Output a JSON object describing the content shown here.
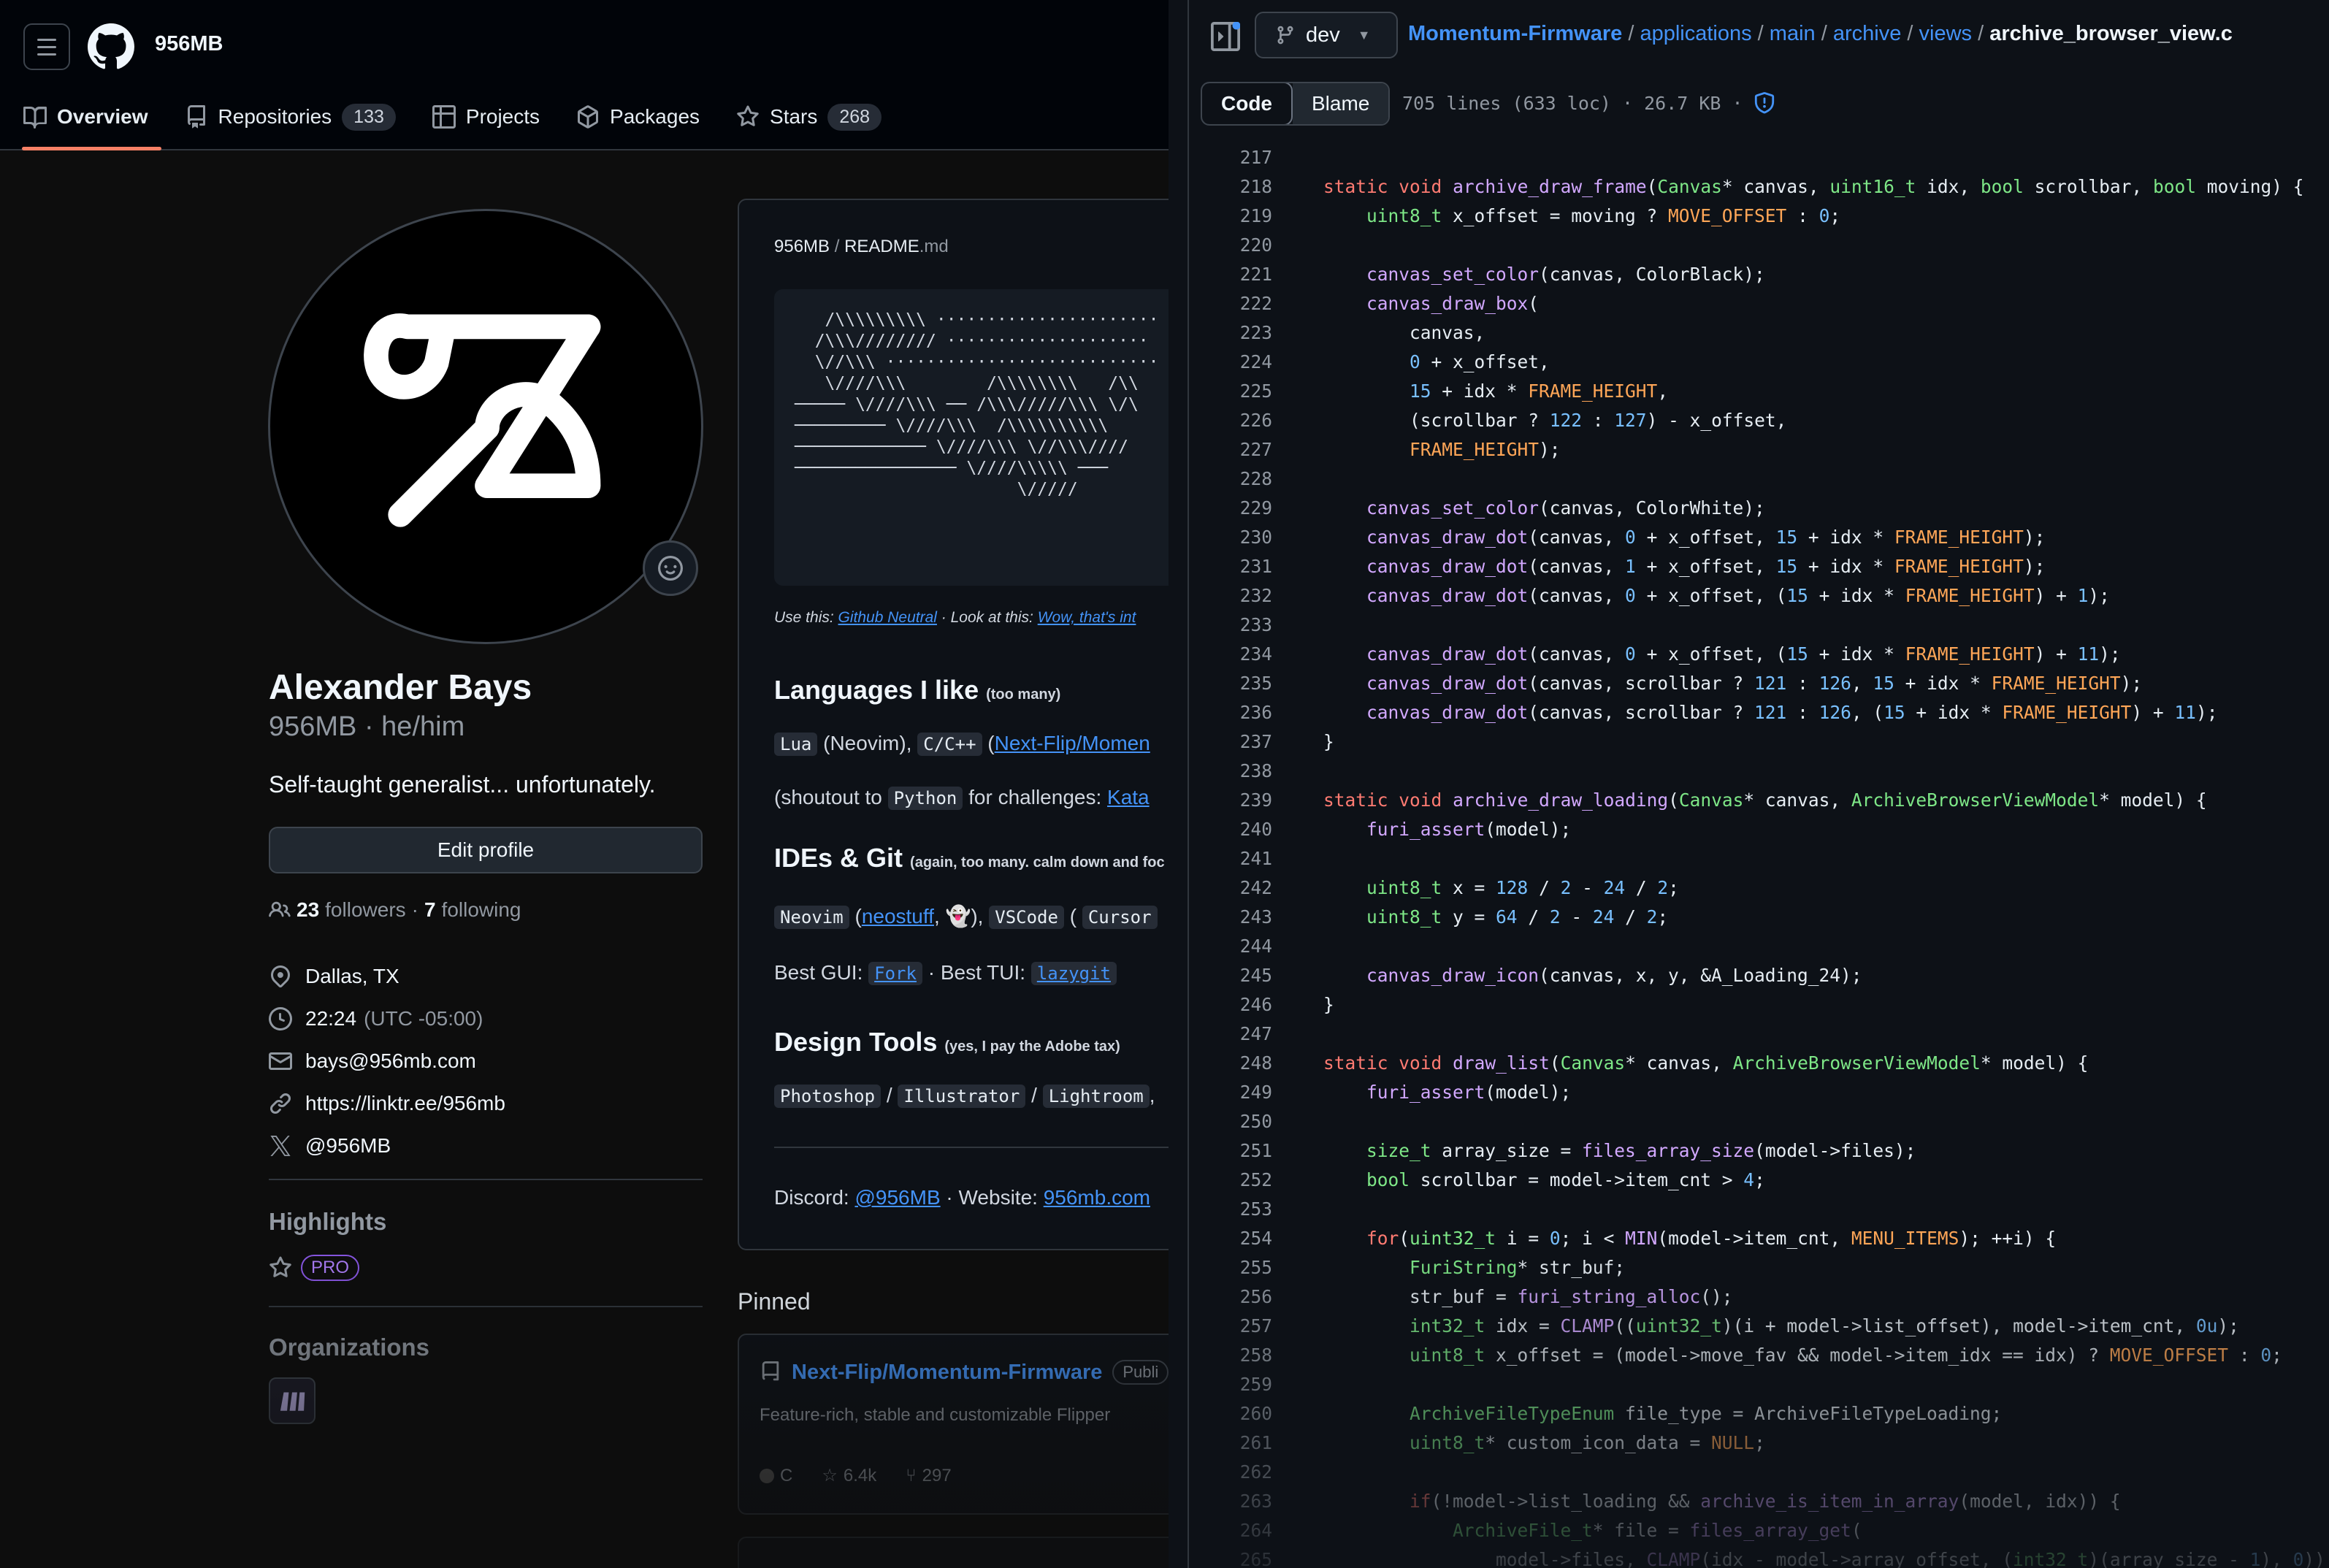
{
  "profile_header": {
    "owner": "956MB",
    "nav": [
      {
        "label": "Overview",
        "count": ""
      },
      {
        "label": "Repositories",
        "count": "133"
      },
      {
        "label": "Projects",
        "count": ""
      },
      {
        "label": "Packages",
        "count": ""
      },
      {
        "label": "Stars",
        "count": "268"
      }
    ]
  },
  "profile": {
    "name": "Alexander Bays",
    "login": "956MB · he/him",
    "bio": "Self-taught generalist... unfortunately.",
    "edit_button": "Edit profile",
    "followers": "23",
    "followers_label": "followers",
    "dot": "·",
    "following": "7",
    "following_label": "following",
    "location": "Dallas, TX",
    "time": "22:24",
    "timezone": "(UTC -05:00)",
    "email": "bays@956mb.com",
    "website": "https://linktr.ee/956mb",
    "x_handle": "@956MB",
    "highlights_title": "Highlights",
    "pro_badge": "PRO",
    "organizations_title": "Organizations"
  },
  "readme": {
    "path_owner": "956MB",
    "path_sep": "/",
    "path_file": "README",
    "path_ext": ".md",
    "ascii_art": "   /\\\\\\\\\\\\\\\\\\ ······················\n  /\\\\\\//////// ····················\n  \\//\\\\\\ ···························\n   \\////\\\\\\        /\\\\\\\\\\\\\\\\   /\\\\\n───── \\////\\\\\\ ── /\\\\\\/////\\\\\\ \\/\\\n───────── \\////\\\\\\  /\\\\\\\\\\\\\\\\\\\\\n───────────── \\////\\\\\\ \\//\\\\\\////\n──────────────── \\////\\\\\\\\\\ ───\n                      \\/////",
    "use_this_label": "Use this:",
    "use_this_link": "Github Neutral",
    "look_label": "· Look at this:",
    "look_link": "Wow, that's int",
    "languages_title": "Languages I like",
    "languages_note": "(too many)",
    "lang_lua": "Lua",
    "lang_neovim": "(Neovim),",
    "lang_cpp": "C/C++",
    "lang_paren": "(",
    "lang_link": "Next-Flip/Momen",
    "shoutout_pre": "(shoutout to",
    "lang_python": "Python",
    "shoutout_post": "for challenges:",
    "shoutout_link": "Kata",
    "ides_title": "IDEs & Git",
    "ides_note": "(again, too many. calm down and foc",
    "ide_neovim": "Neovim",
    "ide_paren": "(",
    "ide_link": "neostuff",
    "ide_after": ", 👻),",
    "ide_vscode": "VSCode",
    "ide_paren2": "(",
    "ide_cursor": "Cursor",
    "gui_label": "Best GUI:",
    "gui_value": "Fork",
    "tui_label": "· Best TUI:",
    "tui_value": "lazygit",
    "design_title": "Design Tools",
    "design_note": "(yes, I pay the Adobe tax)",
    "tool_ps": "Photoshop",
    "slash": "/",
    "tool_ai": "Illustrator",
    "tool_lr": "Lightroom",
    "tool_comma": ",",
    "discord_label": "Discord:",
    "discord_value": "@956MB",
    "website_label": "· Website:",
    "website_value": "956mb.com"
  },
  "pinned": {
    "title": "Pinned",
    "repo": "Next-Flip/Momentum-Firmware",
    "visibility": "Publi",
    "description": "Feature-rich, stable and customizable Flipper",
    "language": "C",
    "stars": "6.4k",
    "forks": "297"
  },
  "code_view": {
    "branch": "dev",
    "breadcrumbs": [
      {
        "label": "Momentum-Firmware",
        "sep": "/"
      },
      {
        "label": "applications",
        "sep": "/"
      },
      {
        "label": "main",
        "sep": "/"
      },
      {
        "label": "archive",
        "sep": "/"
      },
      {
        "label": "views",
        "sep": "/"
      }
    ],
    "filename": "archive_browser_view.c",
    "tab_code": "Code",
    "tab_blame": "Blame",
    "file_info": "705 lines (633 loc) · 26.7 KB ·",
    "lines": [
      {
        "n": "217",
        "t": ""
      },
      {
        "n": "218",
        "t": "static void archive_draw_frame(Canvas* canvas, uint16_t idx, bool scrollbar, bool moving) {"
      },
      {
        "n": "219",
        "t": "    uint8_t x_offset = moving ? MOVE_OFFSET : 0;"
      },
      {
        "n": "220",
        "t": ""
      },
      {
        "n": "221",
        "t": "    canvas_set_color(canvas, ColorBlack);"
      },
      {
        "n": "222",
        "t": "    canvas_draw_box("
      },
      {
        "n": "223",
        "t": "        canvas,"
      },
      {
        "n": "224",
        "t": "        0 + x_offset,"
      },
      {
        "n": "225",
        "t": "        15 + idx * FRAME_HEIGHT,"
      },
      {
        "n": "226",
        "t": "        (scrollbar ? 122 : 127) - x_offset,"
      },
      {
        "n": "227",
        "t": "        FRAME_HEIGHT);"
      },
      {
        "n": "228",
        "t": ""
      },
      {
        "n": "229",
        "t": "    canvas_set_color(canvas, ColorWhite);"
      },
      {
        "n": "230",
        "t": "    canvas_draw_dot(canvas, 0 + x_offset, 15 + idx * FRAME_HEIGHT);"
      },
      {
        "n": "231",
        "t": "    canvas_draw_dot(canvas, 1 + x_offset, 15 + idx * FRAME_HEIGHT);"
      },
      {
        "n": "232",
        "t": "    canvas_draw_dot(canvas, 0 + x_offset, (15 + idx * FRAME_HEIGHT) + 1);"
      },
      {
        "n": "233",
        "t": ""
      },
      {
        "n": "234",
        "t": "    canvas_draw_dot(canvas, 0 + x_offset, (15 + idx * FRAME_HEIGHT) + 11);"
      },
      {
        "n": "235",
        "t": "    canvas_draw_dot(canvas, scrollbar ? 121 : 126, 15 + idx * FRAME_HEIGHT);"
      },
      {
        "n": "236",
        "t": "    canvas_draw_dot(canvas, scrollbar ? 121 : 126, (15 + idx * FRAME_HEIGHT) + 11);"
      },
      {
        "n": "237",
        "t": "}"
      },
      {
        "n": "238",
        "t": ""
      },
      {
        "n": "239",
        "t": "static void archive_draw_loading(Canvas* canvas, ArchiveBrowserViewModel* model) {"
      },
      {
        "n": "240",
        "t": "    furi_assert(model);"
      },
      {
        "n": "241",
        "t": ""
      },
      {
        "n": "242",
        "t": "    uint8_t x = 128 / 2 - 24 / 2;"
      },
      {
        "n": "243",
        "t": "    uint8_t y = 64 / 2 - 24 / 2;"
      },
      {
        "n": "244",
        "t": ""
      },
      {
        "n": "245",
        "t": "    canvas_draw_icon(canvas, x, y, &A_Loading_24);"
      },
      {
        "n": "246",
        "t": "}"
      },
      {
        "n": "247",
        "t": ""
      },
      {
        "n": "248",
        "t": "static void draw_list(Canvas* canvas, ArchiveBrowserViewModel* model) {"
      },
      {
        "n": "249",
        "t": "    furi_assert(model);"
      },
      {
        "n": "250",
        "t": ""
      },
      {
        "n": "251",
        "t": "    size_t array_size = files_array_size(model->files);"
      },
      {
        "n": "252",
        "t": "    bool scrollbar = model->item_cnt > 4;"
      },
      {
        "n": "253",
        "t": ""
      },
      {
        "n": "254",
        "t": "    for(uint32_t i = 0; i < MIN(model->item_cnt, MENU_ITEMS); ++i) {"
      },
      {
        "n": "255",
        "t": "        FuriString* str_buf;"
      },
      {
        "n": "256",
        "t": "        str_buf = furi_string_alloc();"
      },
      {
        "n": "257",
        "t": "        int32_t idx = CLAMP((uint32_t)(i + model->list_offset), model->item_cnt, 0u);"
      },
      {
        "n": "258",
        "t": "        uint8_t x_offset = (model->move_fav && model->item_idx == idx) ? MOVE_OFFSET : 0;"
      },
      {
        "n": "259",
        "t": ""
      },
      {
        "n": "260",
        "t": "        ArchiveFileTypeEnum file_type = ArchiveFileTypeLoading;"
      },
      {
        "n": "261",
        "t": "        uint8_t* custom_icon_data = NULL;"
      },
      {
        "n": "262",
        "t": ""
      },
      {
        "n": "263",
        "t": "        if(!model->list_loading && archive_is_item_in_array(model, idx)) {"
      },
      {
        "n": "264",
        "t": "            ArchiveFile_t* file = files_array_get("
      },
      {
        "n": "265",
        "t": "                model->files, CLAMP(idx - model->array_offset, (int32_t)(array_size - 1), 0));"
      }
    ]
  }
}
